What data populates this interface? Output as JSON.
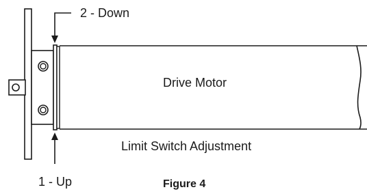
{
  "labels": {
    "down": "2 - Down",
    "motor": "Drive Motor",
    "limit": "Limit Switch Adjustment",
    "up": "1 - Up"
  },
  "caption": "Figure 4",
  "stroke_color": "#1a1a1a",
  "background_color": "#ffffff"
}
